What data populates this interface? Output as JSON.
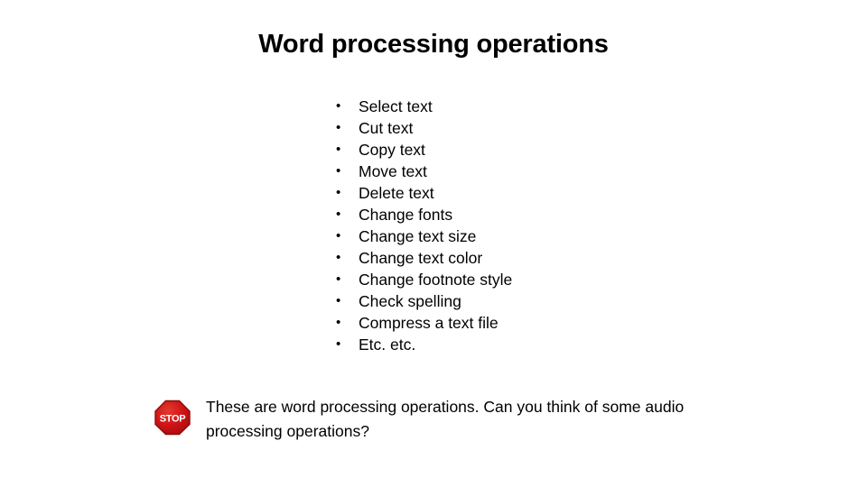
{
  "slide": {
    "background_color": "#ffffff",
    "text_color": "#000000",
    "title": "Word processing operations",
    "bullet_marker": "•",
    "bullets": [
      {
        "label": "Select text"
      },
      {
        "label": "Cut text"
      },
      {
        "label": "Copy text"
      },
      {
        "label": "Move text"
      },
      {
        "label": "Delete text"
      },
      {
        "label": "Change fonts"
      },
      {
        "label": "Change text size"
      },
      {
        "label": "Change text color"
      },
      {
        "label": "Change footnote style"
      },
      {
        "label": "Check spelling"
      },
      {
        "label": "Compress a text file"
      },
      {
        "label": "Etc. etc."
      }
    ],
    "note": {
      "icon": "stop-sign-icon",
      "icon_label": "STOP",
      "icon_color": "#CC1111",
      "icon_border_color": "#8E0B0B",
      "text": "These are word processing operations.  Can you think of some audio processing operations?"
    }
  }
}
